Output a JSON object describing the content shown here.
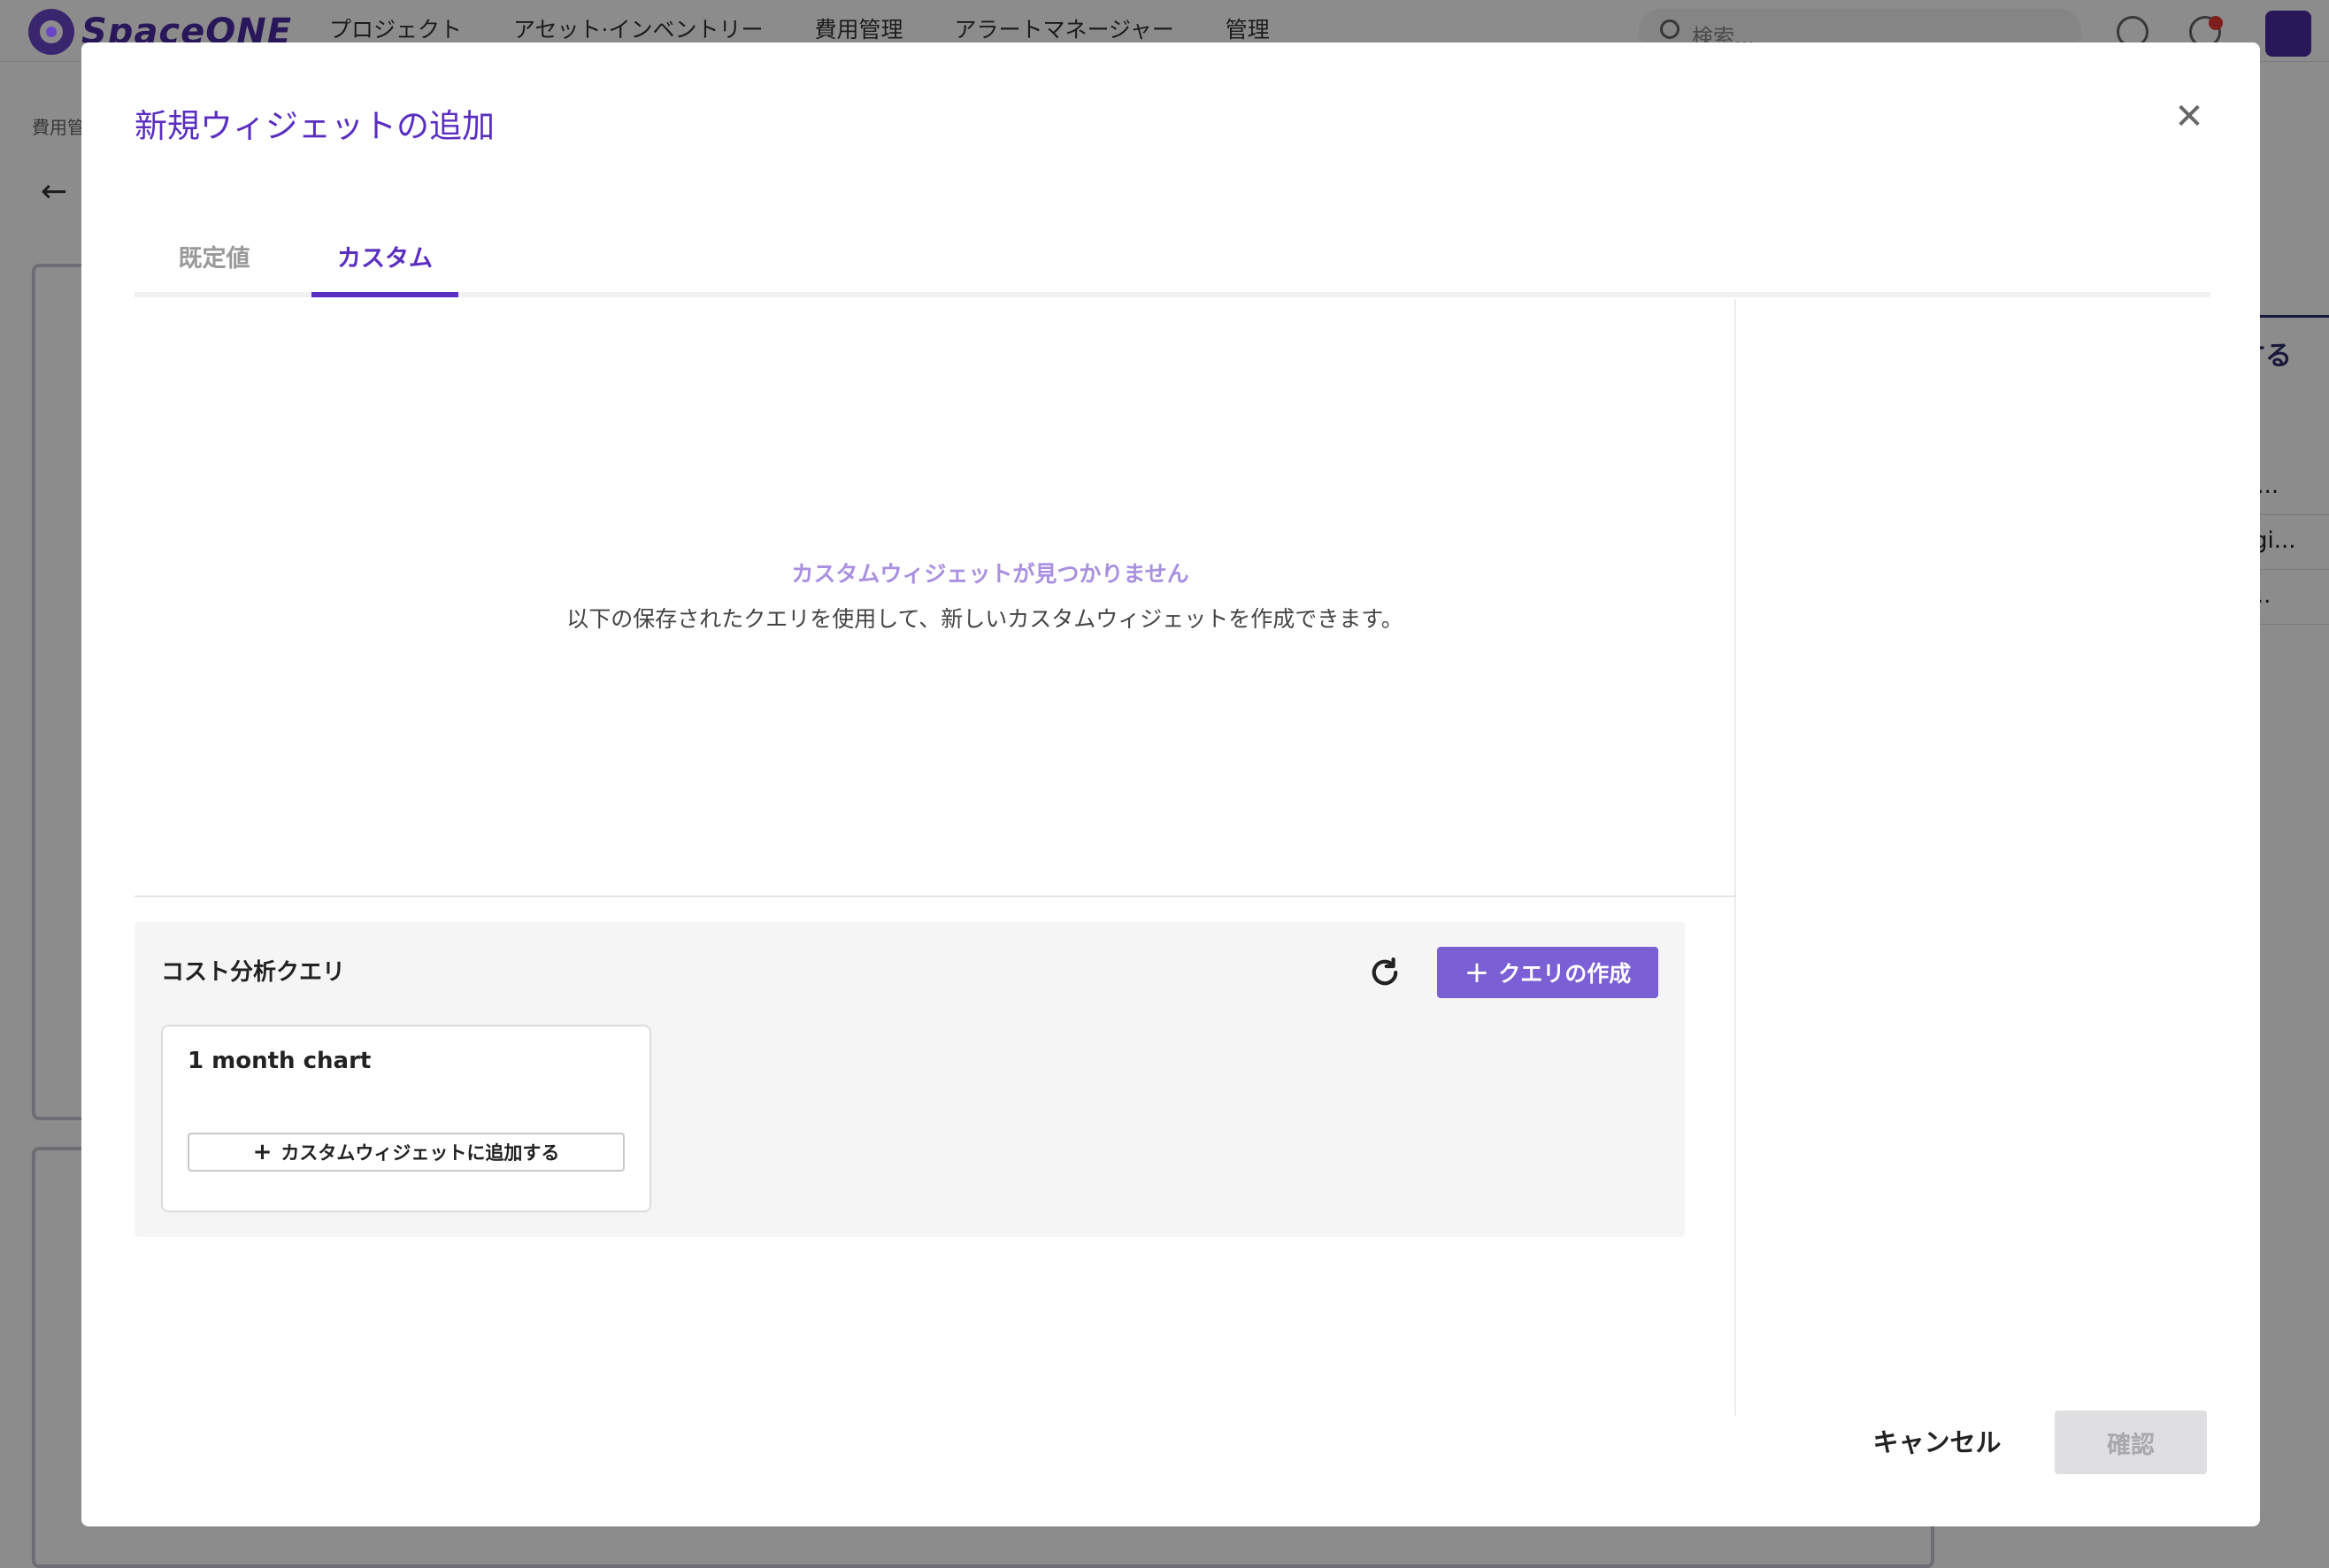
{
  "app": {
    "logo_text": "SpaceONE",
    "nav": [
      "プロジェクト",
      "アセット·インベントリー",
      "費用管理",
      "アラートマネージャー",
      "管理"
    ],
    "search_placeholder": "検索...",
    "breadcrumb": "費用管",
    "right_panel_button": "加する",
    "right_panel_rows": [
      "Tr...",
      "egi...",
      "P..."
    ]
  },
  "modal": {
    "title": "新規ウィジェットの追加",
    "tabs": [
      {
        "label": "既定値",
        "active": false
      },
      {
        "label": "カスタム",
        "active": true
      }
    ],
    "empty_state": {
      "title": "カスタムウィジェットが見つかりません",
      "description": "以下の保存されたクエリを使用して、新しいカスタムウィジェットを作成できます。"
    },
    "query_panel": {
      "title": "コスト分析クエリ",
      "create_label": "クエリの作成",
      "queries": [
        {
          "name": "1 month chart",
          "add_label": "カスタムウィジェットに追加する"
        }
      ]
    },
    "footer": {
      "cancel_label": "キャンセル",
      "confirm_label": "確認"
    }
  },
  "colors": {
    "accent": "#5a2ec0",
    "primary_button": "#7b5fd4",
    "empty_title": "#a990e0",
    "overlay": "rgba(0,0,0,0.45)"
  }
}
